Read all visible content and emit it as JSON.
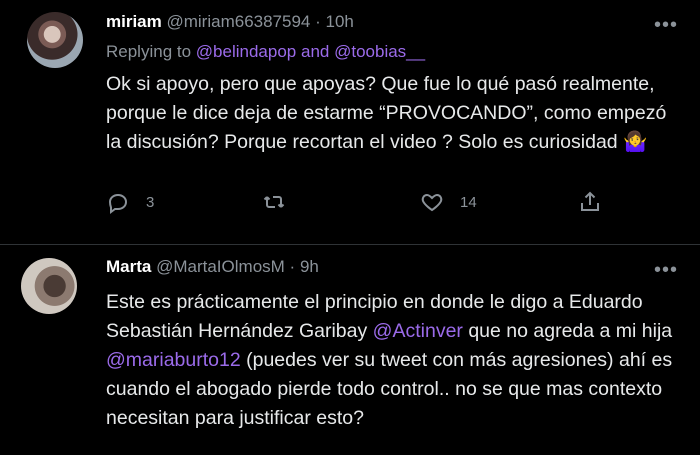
{
  "tweets": [
    {
      "name": "miriam",
      "handle": "@miriam66387594",
      "time": "10h",
      "replying_label": "Replying to",
      "replying_to_1": "@belindapop",
      "replying_and": "and",
      "replying_to_2": "@toobias__",
      "text": "Ok si apoyo, pero que apoyas? Que fue lo qué pasó realmente, porque le dice deja de estarme “PROVOCANDO”, como empezó la discusión? Porque recortan el video ? Solo es curiosidad 🤷‍♀️",
      "reply_count": "3",
      "like_count": "14"
    },
    {
      "name": "Marta",
      "handle": "@MartaIOlmosM",
      "time": "9h",
      "text_parts": {
        "p1": "Este es prácticamente el principio en donde le digo a Eduardo Sebastián Hernández Garibay ",
        "m1": "@Actinver",
        "p2": " que no agreda a mi hija ",
        "m2": "@mariaburto12",
        "p3": " (puedes ver su tweet con más agresiones) ahí es cuando el abogado pierde todo control.. no se que mas contexto necesitan para justificar esto?"
      }
    }
  ],
  "icons": {
    "more": "more-icon",
    "reply": "reply-icon",
    "retweet": "retweet-icon",
    "like": "heart-icon",
    "share": "share-icon"
  }
}
